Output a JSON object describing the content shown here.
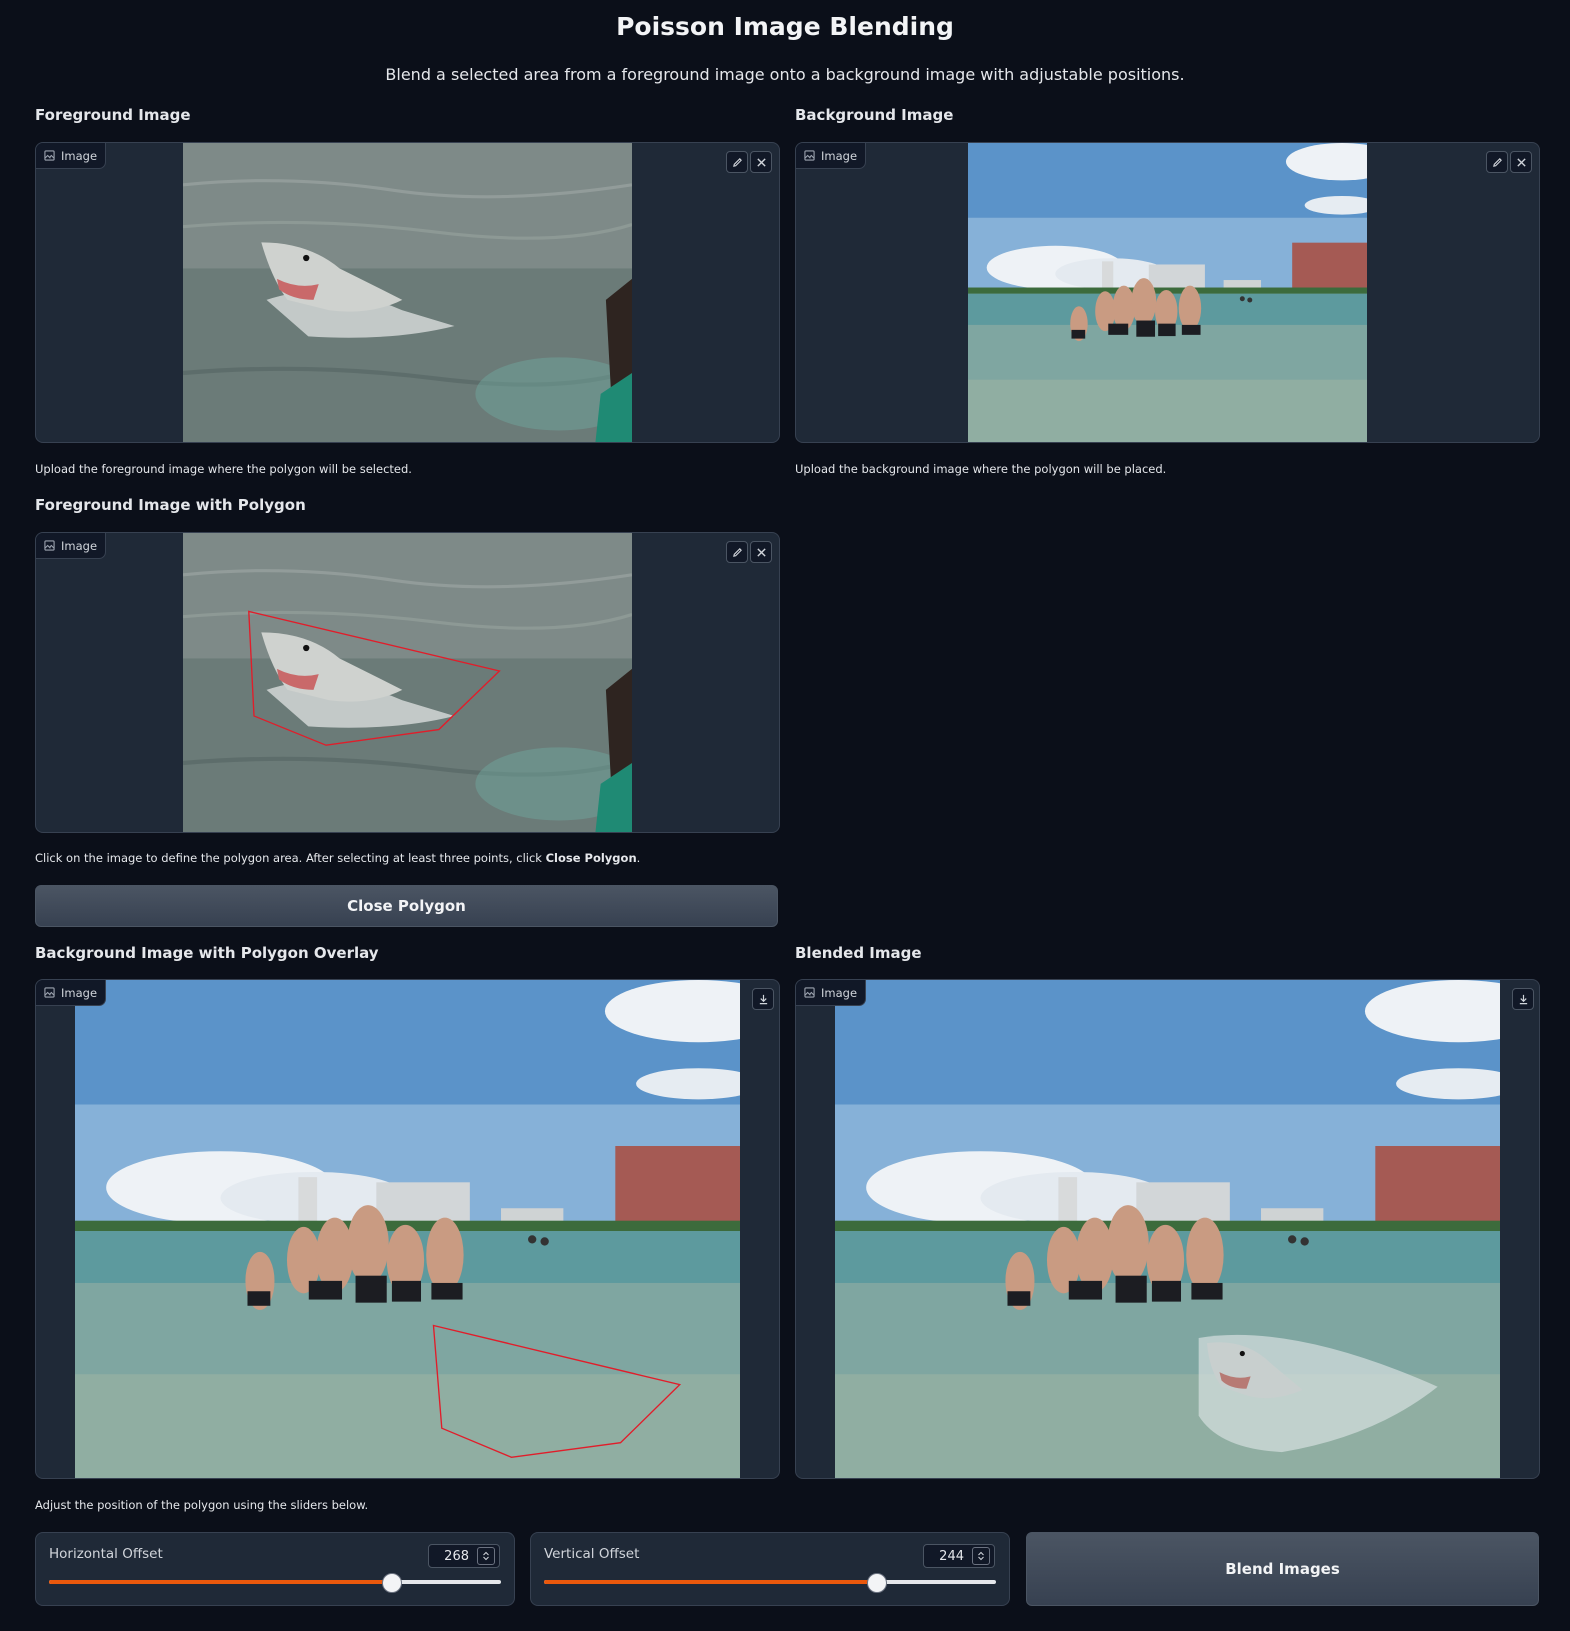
{
  "header": {
    "title": "Poisson Image Blending",
    "subtitle": "Blend a selected area from a foreground image onto a background image with adjustable positions."
  },
  "image_badge_label": "Image",
  "foreground": {
    "label": "Foreground Image",
    "caption": "Upload the foreground image where the polygon will be selected."
  },
  "background": {
    "label": "Background Image",
    "caption": "Upload the background image where the polygon will be placed."
  },
  "polygon_fg": {
    "label": "Foreground Image with Polygon",
    "caption_prefix": "Click on the image to define the polygon area. After selecting at least three points, click ",
    "caption_bold": "Close Polygon",
    "caption_suffix": "."
  },
  "close_button": "Close Polygon",
  "overlay": {
    "label": "Background Image with Polygon Overlay"
  },
  "blended": {
    "label": "Blended Image"
  },
  "sliders_caption": "Adjust the position of the polygon using the sliders below.",
  "sliders": {
    "horizontal": {
      "label": "Horizontal Offset",
      "value": "268",
      "fraction": 0.757
    },
    "vertical": {
      "label": "Vertical Offset",
      "value": "244",
      "fraction": 0.735
    }
  },
  "blend_button": "Blend Images",
  "icons": [
    "image-icon",
    "edit-icon",
    "close-icon",
    "download-icon",
    "spin-arrows-icon"
  ],
  "colors": {
    "accent": "#ea580c",
    "polygon": "#e11d2a",
    "background": "#0b0f19",
    "panel": "#1f2937"
  }
}
